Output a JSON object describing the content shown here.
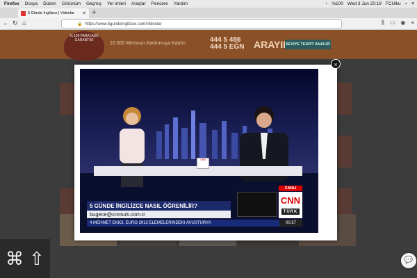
{
  "menubar": {
    "app_name": "Firefox",
    "items": [
      "Dosya",
      "Düzen",
      "Görünüm",
      "Geçmiş",
      "Yer imleri",
      "Araçlar",
      "Pencere",
      "Yardım"
    ],
    "battery": "%100",
    "datetime": "Wed 3 Jun  20:19",
    "user": "FCUlku"
  },
  "browser": {
    "tab_title": "5 Günde İngilizce | Videolar",
    "url": "https://www.5gundeingilizce.com/Videolar"
  },
  "site_header": {
    "badge_text": "% 100 PARA İADE GARANTİSİ",
    "tagline": "10.000 Memnun Katılımcıya Katılın",
    "phone_line1": "444 5 486",
    "phone_line2": "444 5 EĞN",
    "cta": "ARAYIN",
    "level_button": "SEVİYE TESPİT ANALİZİ"
  },
  "video": {
    "title_strap": "5 GÜNDE İNGİLİZCE NASIL ÖĞRENİLİR?",
    "email_strap": "bugece@cnnturk.com.tr",
    "ticker": "4 MEHMET EKICI, EURO 2012 ELEMELERINDEKI AVUSTURYA",
    "ticker_time": "00.57",
    "live_label": "CANLI",
    "channel_name": "CNN",
    "channel_sub": "TÜRK",
    "mug_label": "CNN"
  },
  "modal": {
    "close_glyph": "×"
  },
  "overlay": {
    "cmd_glyph": "⌘",
    "shift_glyph": "⇧",
    "chat_glyph": "💬"
  },
  "colors": {
    "header_bg": "#8a5128",
    "news_blue": "#1d2a6a",
    "cnn_red": "#d80000"
  }
}
